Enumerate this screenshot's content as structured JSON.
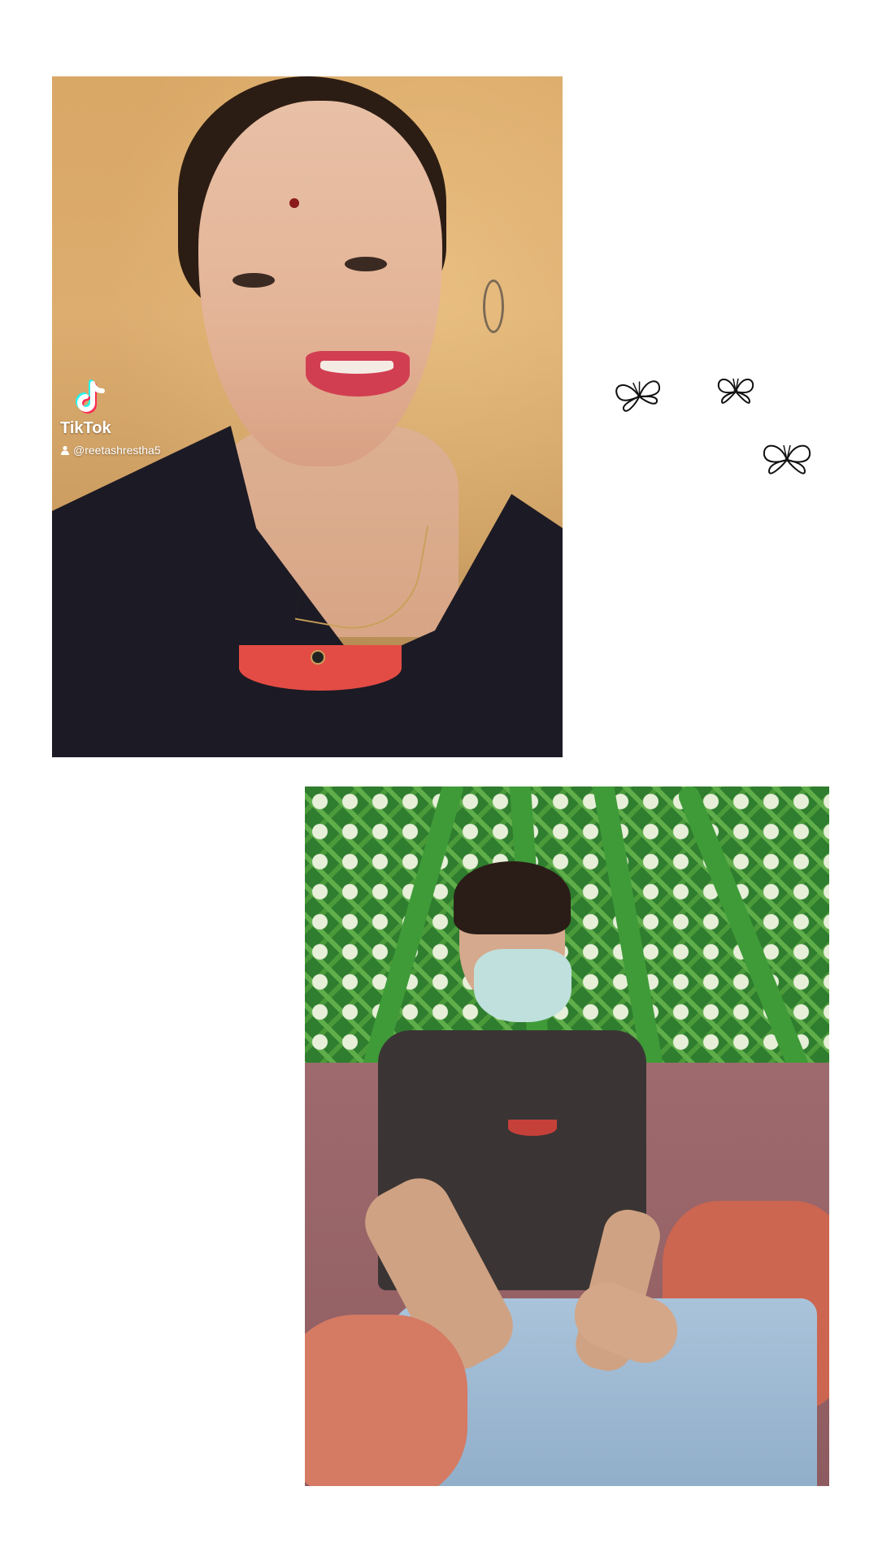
{
  "photos": {
    "top": {
      "description_icon": "selfie-photo"
    },
    "bottom": {
      "description_icon": "seated-photo"
    }
  },
  "watermark": {
    "brand": "TikTok",
    "handle": "@reetashrestha5",
    "logo_icon": "tiktok-logo-icon",
    "user_icon": "user-icon"
  },
  "decorations": {
    "butterflies": [
      "butterfly-icon",
      "butterfly-icon",
      "butterfly-icon"
    ]
  },
  "colors": {
    "background": "#ffffff",
    "tiktok_cyan": "#25f4ee",
    "tiktok_pink": "#fe2c55",
    "butterfly_stroke": "#111111"
  }
}
